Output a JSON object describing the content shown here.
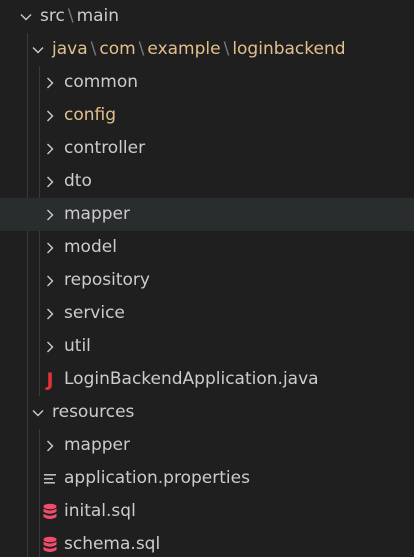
{
  "colors": {
    "background": "#1f1f1f",
    "text": "#cccccc",
    "modified_text": "#e2c08d",
    "hover_row": "#2a2d2e",
    "separator": "#7a7a7a",
    "java_icon": "#e2333a",
    "sql_icon": "#f14c6b"
  },
  "explorer": {
    "root": {
      "segments": [
        "src",
        "main"
      ],
      "expanded": true,
      "icon": "chevron-down-icon"
    },
    "java_package": {
      "segments": [
        "java",
        "com",
        "example",
        "loginbackend"
      ],
      "expanded": true,
      "icon": "chevron-down-icon"
    },
    "packages": [
      {
        "label": "common",
        "icon": "chevron-right-icon"
      },
      {
        "label": "config",
        "icon": "chevron-right-icon",
        "modified": true
      },
      {
        "label": "controller",
        "icon": "chevron-right-icon"
      },
      {
        "label": "dto",
        "icon": "chevron-right-icon"
      },
      {
        "label": "mapper",
        "icon": "chevron-right-icon",
        "hovered": true
      },
      {
        "label": "model",
        "icon": "chevron-right-icon"
      },
      {
        "label": "repository",
        "icon": "chevron-right-icon"
      },
      {
        "label": "service",
        "icon": "chevron-right-icon"
      },
      {
        "label": "util",
        "icon": "chevron-right-icon"
      }
    ],
    "app_file": {
      "label": "LoginBackendApplication.java",
      "icon": "java-file-icon",
      "glyph": "J"
    },
    "resources": {
      "label": "resources",
      "expanded": true,
      "icon": "chevron-down-icon"
    },
    "resource_items": [
      {
        "label": "mapper",
        "icon": "chevron-right-icon"
      },
      {
        "label": "application.properties",
        "icon": "properties-file-icon"
      },
      {
        "label": "inital.sql",
        "icon": "database-icon"
      },
      {
        "label": "schema.sql",
        "icon": "database-icon"
      }
    ]
  }
}
